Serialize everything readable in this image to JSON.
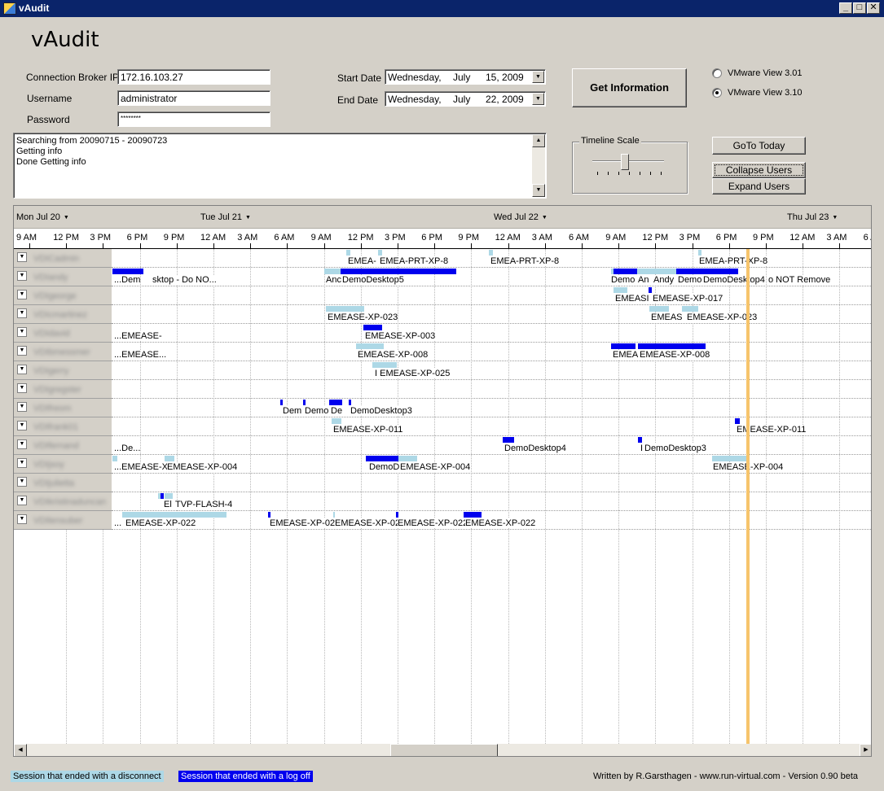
{
  "window": {
    "title": "vAudit",
    "min": "_",
    "max": "□",
    "close": "✕"
  },
  "app_title": "vAudit",
  "form": {
    "broker_label": "Connection Broker IP",
    "broker_value": "172.16.103.27",
    "username_label": "Username",
    "username_value": "administrator",
    "password_label": "Password",
    "password_value": "********",
    "start_label": "Start Date",
    "start_day": "Wednesday,",
    "start_month": "July",
    "start_date": "15, 2009",
    "end_label": "End Date",
    "end_day": "Wednesday,",
    "end_month": "July",
    "end_date": "22, 2009",
    "get_info": "Get Information",
    "radio_301": "VMware View 3.01",
    "radio_310": "VMware View 3.10",
    "selected_version": "VMware View 3.10"
  },
  "log": {
    "lines": [
      "Searching from 20090715 - 20090723",
      "Getting info",
      "Done Getting info"
    ]
  },
  "timeline_scale": {
    "label": "Timeline Scale",
    "level": 0.45
  },
  "buttons": {
    "goto_today": "GoTo Today",
    "collapse": "Collapse Users",
    "expand": "Expand Users"
  },
  "timeline": {
    "days": [
      "Mon Jul 20",
      "Tue Jul 21",
      "Wed Jul 22",
      "Thu Jul 23"
    ],
    "hours": [
      "9 AM",
      "12 PM",
      "3 PM",
      "6 PM",
      "9 PM",
      "12 AM",
      "3 AM",
      "6 AM",
      "9 AM",
      "12 PM",
      "3 PM",
      "6 PM",
      "9 PM",
      "12 AM",
      "3 AM",
      "6 AM",
      "9 AM",
      "12 PM",
      "3 PM",
      "6 PM",
      "9 PM",
      "12 AM",
      "3 AM",
      "6 A"
    ],
    "users": [
      "VDICadmin",
      "VDIandy",
      "VDIgeorge",
      "VDIcmartinez",
      "VDIdavid",
      "VDIbmessmer",
      "VDIgerry",
      "VDIgregster",
      "VDIfreom",
      "VDIfrank01",
      "VDIfernand",
      "VDIjsoy",
      "VDIjulietta",
      "VDIkristinaduncan",
      "VDIlensuber"
    ],
    "session_labels": [
      [
        "EMEA-",
        "EMEA-PRT-XP-8",
        "EMEA-PRT-XP-8",
        "EMEA-PRT-XP-8"
      ],
      [
        "...Dem",
        "sktop - Do NO...",
        "Anc",
        "DemoDesktop5",
        "Demo",
        "An",
        "Andy",
        "Demo",
        "DemoDesktop4",
        "o NOT Remove"
      ],
      [
        "EMEASI",
        "EMEASE-XP-017"
      ],
      [
        "EMEASE-XP-023",
        "EMEAS",
        "EMEASE-XP-023"
      ],
      [
        "...EMEASE-",
        "EMEASE-XP-003"
      ],
      [
        "...EMEASE...",
        "EMEASE-XP-008",
        "EMEA",
        "EMEASE-XP-008"
      ],
      [
        "I EMEASE-XP-025"
      ],
      [],
      [
        "Dem",
        "Demo D",
        "De",
        "DemoDesktop3"
      ],
      [
        "EMEASE-XP-011",
        "EMEASE-XP-011"
      ],
      [
        "...De...",
        "DemoDesktop4",
        "I",
        "DemoDesktop3"
      ],
      [
        "...EMEASE-X",
        "EMEASE-XP-004",
        "DemoD",
        "EMEASE-XP-004",
        "EMEASE-XP-004"
      ],
      [],
      [
        "El",
        "TVP-FLASH-4"
      ],
      [
        "...",
        "EMEASE-XP-022",
        "EMEASE-XP-022",
        "EMEASE-XP-02",
        "EMEASE-XP-022",
        "EMEASE-XP-022"
      ]
    ]
  },
  "legend": {
    "disconnect": "Session that ended with a disconnect",
    "logoff": "Session that ended with a log off"
  },
  "footer": "Written by R.Garsthagen - www.run-virtual.com - Version 0.90 beta",
  "colors": {
    "disconnect": "#add8e6",
    "logoff": "#0000ee",
    "today_marker": "#f6c46c",
    "titlebar": "#0a246a"
  }
}
